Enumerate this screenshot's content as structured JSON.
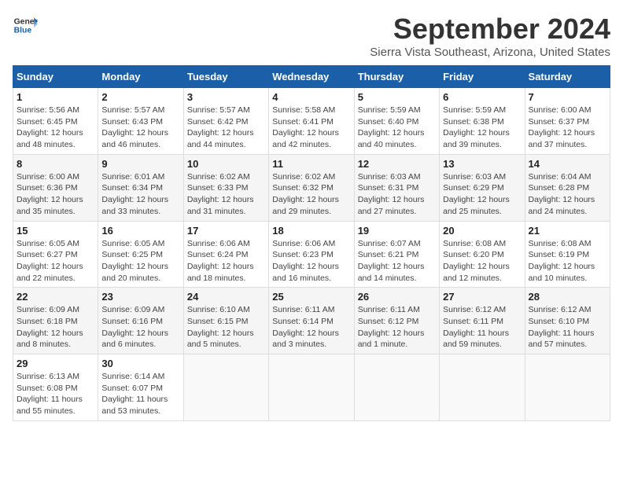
{
  "logo": {
    "line1": "General",
    "line2": "Blue"
  },
  "title": "September 2024",
  "subtitle": "Sierra Vista Southeast, Arizona, United States",
  "days_of_week": [
    "Sunday",
    "Monday",
    "Tuesday",
    "Wednesday",
    "Thursday",
    "Friday",
    "Saturday"
  ],
  "weeks": [
    [
      {
        "day": "1",
        "info": "Sunrise: 5:56 AM\nSunset: 6:45 PM\nDaylight: 12 hours\nand 48 minutes."
      },
      {
        "day": "2",
        "info": "Sunrise: 5:57 AM\nSunset: 6:43 PM\nDaylight: 12 hours\nand 46 minutes."
      },
      {
        "day": "3",
        "info": "Sunrise: 5:57 AM\nSunset: 6:42 PM\nDaylight: 12 hours\nand 44 minutes."
      },
      {
        "day": "4",
        "info": "Sunrise: 5:58 AM\nSunset: 6:41 PM\nDaylight: 12 hours\nand 42 minutes."
      },
      {
        "day": "5",
        "info": "Sunrise: 5:59 AM\nSunset: 6:40 PM\nDaylight: 12 hours\nand 40 minutes."
      },
      {
        "day": "6",
        "info": "Sunrise: 5:59 AM\nSunset: 6:38 PM\nDaylight: 12 hours\nand 39 minutes."
      },
      {
        "day": "7",
        "info": "Sunrise: 6:00 AM\nSunset: 6:37 PM\nDaylight: 12 hours\nand 37 minutes."
      }
    ],
    [
      {
        "day": "8",
        "info": "Sunrise: 6:00 AM\nSunset: 6:36 PM\nDaylight: 12 hours\nand 35 minutes."
      },
      {
        "day": "9",
        "info": "Sunrise: 6:01 AM\nSunset: 6:34 PM\nDaylight: 12 hours\nand 33 minutes."
      },
      {
        "day": "10",
        "info": "Sunrise: 6:02 AM\nSunset: 6:33 PM\nDaylight: 12 hours\nand 31 minutes."
      },
      {
        "day": "11",
        "info": "Sunrise: 6:02 AM\nSunset: 6:32 PM\nDaylight: 12 hours\nand 29 minutes."
      },
      {
        "day": "12",
        "info": "Sunrise: 6:03 AM\nSunset: 6:31 PM\nDaylight: 12 hours\nand 27 minutes."
      },
      {
        "day": "13",
        "info": "Sunrise: 6:03 AM\nSunset: 6:29 PM\nDaylight: 12 hours\nand 25 minutes."
      },
      {
        "day": "14",
        "info": "Sunrise: 6:04 AM\nSunset: 6:28 PM\nDaylight: 12 hours\nand 24 minutes."
      }
    ],
    [
      {
        "day": "15",
        "info": "Sunrise: 6:05 AM\nSunset: 6:27 PM\nDaylight: 12 hours\nand 22 minutes."
      },
      {
        "day": "16",
        "info": "Sunrise: 6:05 AM\nSunset: 6:25 PM\nDaylight: 12 hours\nand 20 minutes."
      },
      {
        "day": "17",
        "info": "Sunrise: 6:06 AM\nSunset: 6:24 PM\nDaylight: 12 hours\nand 18 minutes."
      },
      {
        "day": "18",
        "info": "Sunrise: 6:06 AM\nSunset: 6:23 PM\nDaylight: 12 hours\nand 16 minutes."
      },
      {
        "day": "19",
        "info": "Sunrise: 6:07 AM\nSunset: 6:21 PM\nDaylight: 12 hours\nand 14 minutes."
      },
      {
        "day": "20",
        "info": "Sunrise: 6:08 AM\nSunset: 6:20 PM\nDaylight: 12 hours\nand 12 minutes."
      },
      {
        "day": "21",
        "info": "Sunrise: 6:08 AM\nSunset: 6:19 PM\nDaylight: 12 hours\nand 10 minutes."
      }
    ],
    [
      {
        "day": "22",
        "info": "Sunrise: 6:09 AM\nSunset: 6:18 PM\nDaylight: 12 hours\nand 8 minutes."
      },
      {
        "day": "23",
        "info": "Sunrise: 6:09 AM\nSunset: 6:16 PM\nDaylight: 12 hours\nand 6 minutes."
      },
      {
        "day": "24",
        "info": "Sunrise: 6:10 AM\nSunset: 6:15 PM\nDaylight: 12 hours\nand 5 minutes."
      },
      {
        "day": "25",
        "info": "Sunrise: 6:11 AM\nSunset: 6:14 PM\nDaylight: 12 hours\nand 3 minutes."
      },
      {
        "day": "26",
        "info": "Sunrise: 6:11 AM\nSunset: 6:12 PM\nDaylight: 12 hours\nand 1 minute."
      },
      {
        "day": "27",
        "info": "Sunrise: 6:12 AM\nSunset: 6:11 PM\nDaylight: 11 hours\nand 59 minutes."
      },
      {
        "day": "28",
        "info": "Sunrise: 6:12 AM\nSunset: 6:10 PM\nDaylight: 11 hours\nand 57 minutes."
      }
    ],
    [
      {
        "day": "29",
        "info": "Sunrise: 6:13 AM\nSunset: 6:08 PM\nDaylight: 11 hours\nand 55 minutes."
      },
      {
        "day": "30",
        "info": "Sunrise: 6:14 AM\nSunset: 6:07 PM\nDaylight: 11 hours\nand 53 minutes."
      },
      {
        "day": "",
        "info": ""
      },
      {
        "day": "",
        "info": ""
      },
      {
        "day": "",
        "info": ""
      },
      {
        "day": "",
        "info": ""
      },
      {
        "day": "",
        "info": ""
      }
    ]
  ]
}
